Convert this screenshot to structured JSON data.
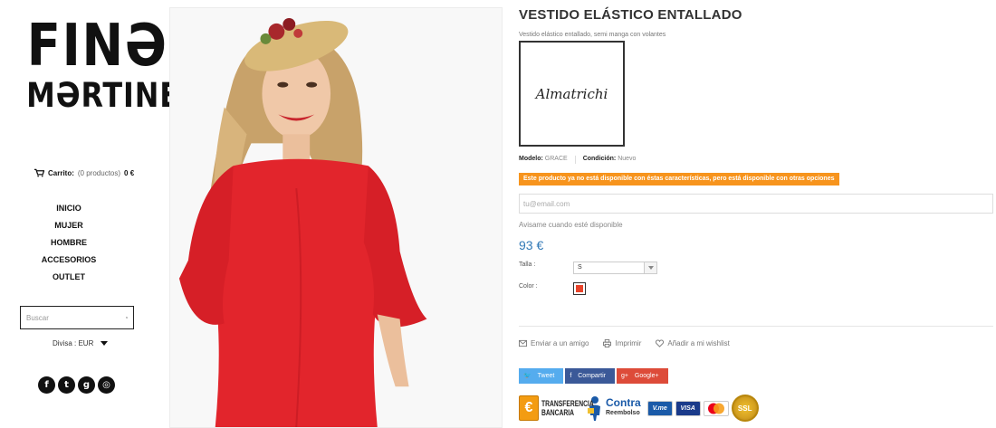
{
  "logo": {
    "line1": "FINƏ",
    "line2": "MƏRTINEZ"
  },
  "cart": {
    "label": "Carrito:",
    "count_text": "(0 productos)",
    "total": "0 €"
  },
  "nav": [
    "INICIO",
    "MUJER",
    "HOMBRE",
    "ACCESORIOS",
    "OUTLET"
  ],
  "search": {
    "placeholder": "Buscar"
  },
  "currency": {
    "label": "Divisa : EUR"
  },
  "social": [
    "facebook",
    "twitter",
    "google-plus",
    "instagram"
  ],
  "product": {
    "title": "VESTIDO ELÁSTICO ENTALLADO",
    "short_description": "Vestido elástico entallado, semi manga con volantes",
    "brand": "Almatrichi",
    "model_label": "Modelo:",
    "model_value": "GRACE",
    "condition_label": "Condición:",
    "condition_value": "Nuevo",
    "availability_alert": "Este producto ya no está disponible con éstas características, pero está disponible con otras opciones",
    "email_placeholder": "tu@email.com",
    "notify_label": "Avisame cuando esté disponible",
    "price": "93 €",
    "size_label": "Talla :",
    "size_value": "S",
    "color_label": "Color :",
    "color_value": "#e8442b"
  },
  "actions": {
    "send": "Enviar a un amigo",
    "print": "Imprimir",
    "wishlist": "Añadir a mi wishlist"
  },
  "share": {
    "tweet": "Tweet",
    "facebook": "Compartir",
    "google": "Google+"
  },
  "payments": {
    "transfer": "TRANSFERENCIA BANCARIA",
    "contra_1": "Contra",
    "contra_2": "Reembolso",
    "vme": "V.me",
    "visa": "VISA",
    "mastercard": "MasterCard",
    "ssl": "SSL"
  },
  "colors": {
    "accent_blue": "#337ab7",
    "alert_orange": "#f7941d",
    "twitter": "#55acee",
    "facebook": "#3b5998",
    "google": "#dd4b39"
  }
}
